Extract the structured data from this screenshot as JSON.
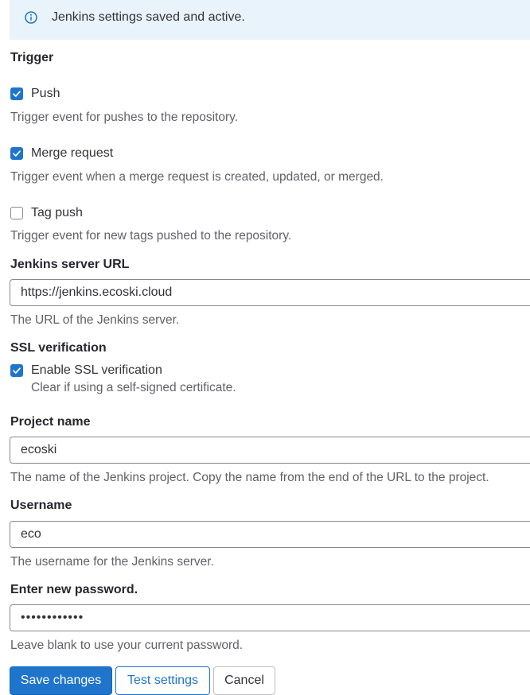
{
  "alert": {
    "icon": "info-icon",
    "message": "Jenkins settings saved and active."
  },
  "trigger": {
    "heading": "Trigger",
    "options": [
      {
        "label": "Push",
        "checked": true,
        "help": "Trigger event for pushes to the repository."
      },
      {
        "label": "Merge request",
        "checked": true,
        "help": "Trigger event when a merge request is created, updated, or merged."
      },
      {
        "label": "Tag push",
        "checked": false,
        "help": "Trigger event for new tags pushed to the repository."
      }
    ]
  },
  "server_url": {
    "label": "Jenkins server URL",
    "value": "https://jenkins.ecoski.cloud",
    "help": "The URL of the Jenkins server."
  },
  "ssl": {
    "label": "SSL verification",
    "checkbox_label": "Enable SSL verification",
    "checked": true,
    "help": "Clear if using a self-signed certificate."
  },
  "project": {
    "label": "Project name",
    "value": "ecoski",
    "help": "The name of the Jenkins project. Copy the name from the end of the URL to the project."
  },
  "username": {
    "label": "Username",
    "value": "eco",
    "help": "The username for the Jenkins server."
  },
  "password": {
    "label": "Enter new password.",
    "masked_value": "••••••••••••",
    "help": "Leave blank to use your current password."
  },
  "buttons": {
    "save": "Save changes",
    "test": "Test settings",
    "cancel": "Cancel"
  },
  "colors": {
    "accent": "#1f75cb",
    "alert_bg": "#e9f3fc"
  }
}
